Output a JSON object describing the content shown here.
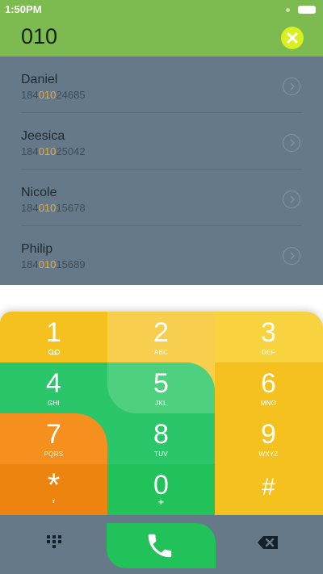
{
  "status_bar": {
    "time": "1:50PM"
  },
  "search": {
    "query": "010"
  },
  "contacts": [
    {
      "name": "Daniel",
      "num_pre": "184",
      "num_match": "010",
      "num_post": "24685"
    },
    {
      "name": "Jeesica",
      "num_pre": "184",
      "num_match": "010",
      "num_post": "25042"
    },
    {
      "name": "Nicole",
      "num_pre": "184",
      "num_match": "010",
      "num_post": "15678"
    },
    {
      "name": "Philip",
      "num_pre": "184",
      "num_match": "010",
      "num_post": "15689"
    }
  ],
  "keypad": {
    "keys": [
      {
        "digit": "1",
        "letters": ""
      },
      {
        "digit": "2",
        "letters": "ABC"
      },
      {
        "digit": "3",
        "letters": "DEF"
      },
      {
        "digit": "4",
        "letters": "GHI"
      },
      {
        "digit": "5",
        "letters": "JKL"
      },
      {
        "digit": "6",
        "letters": "MNO"
      },
      {
        "digit": "7",
        "letters": "PQRS"
      },
      {
        "digit": "8",
        "letters": "TUV"
      },
      {
        "digit": "9",
        "letters": "WXYZ"
      },
      {
        "digit": "*",
        "letters": ","
      },
      {
        "digit": "0",
        "letters": "+"
      },
      {
        "digit": "#",
        "letters": ""
      }
    ]
  },
  "colors": {
    "header_green": "#7dba4f",
    "list_slate": "#667988",
    "highlight_orange": "#f2a72b",
    "key_yellow": "#f4c11f",
    "key_green": "#2bc56a",
    "key_orange": "#f5901e",
    "call_green": "#21c25a"
  },
  "icons": {
    "clear": "close-icon",
    "chevron": "chevron-right-icon",
    "voicemail": "voicemail-icon",
    "dialpad": "dialpad-icon",
    "call": "phone-icon",
    "backspace": "backspace-icon"
  }
}
